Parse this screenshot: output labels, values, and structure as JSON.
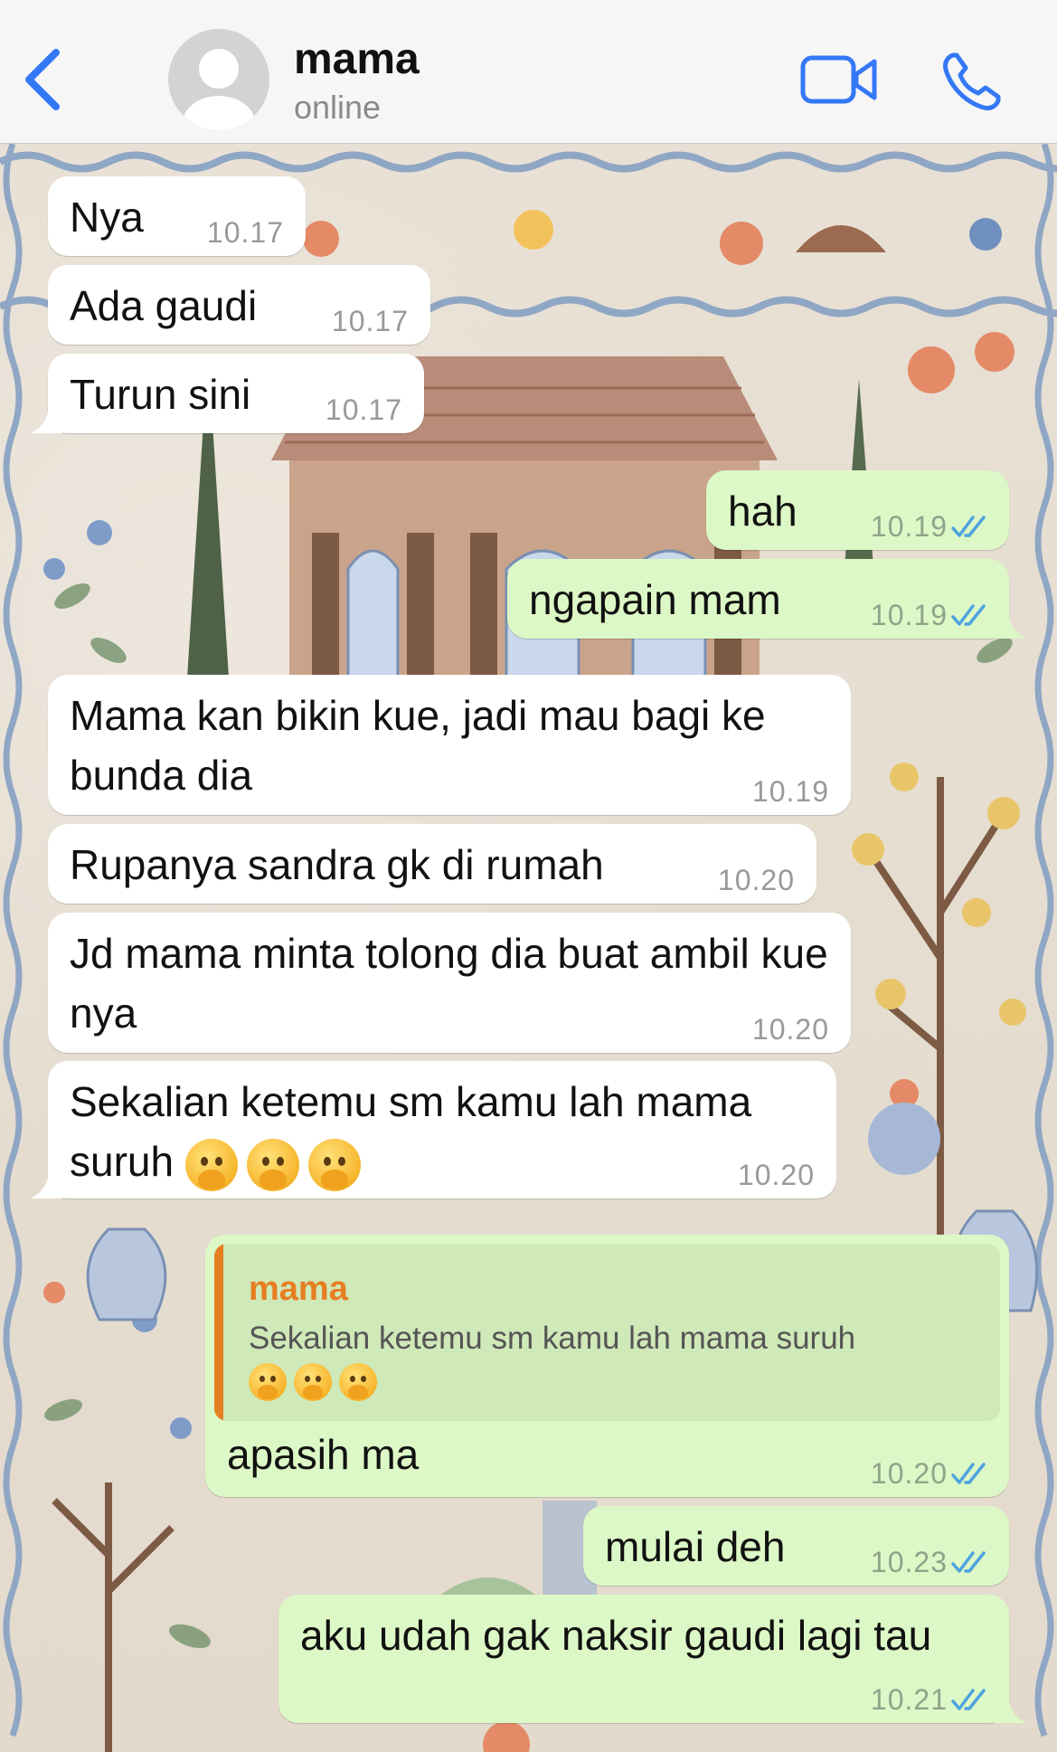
{
  "header": {
    "contact_name": "mama",
    "status": "online",
    "back_icon": "chevron-left-icon",
    "video_icon": "video-camera-icon",
    "call_icon": "phone-icon",
    "accent_color": "#3478f6"
  },
  "messages": [
    {
      "dir": "in",
      "text": "Nya",
      "time": "10.17"
    },
    {
      "dir": "in",
      "text": "Ada gaudi",
      "time": "10.17"
    },
    {
      "dir": "in",
      "text": "Turun sini",
      "time": "10.17"
    },
    {
      "dir": "out",
      "text": "hah",
      "time": "10.19",
      "read": true
    },
    {
      "dir": "out",
      "text": "ngapain mam",
      "time": "10.19",
      "read": true
    },
    {
      "dir": "in",
      "text": "Mama kan bikin kue, jadi mau bagi ke bunda dia",
      "time": "10.19"
    },
    {
      "dir": "in",
      "text": "Rupanya sandra gk di rumah",
      "time": "10.20"
    },
    {
      "dir": "in",
      "text": "Jd mama minta tolong dia buat ambil kue nya",
      "time": "10.20"
    },
    {
      "dir": "in",
      "text": "Sekalian ketemu sm kamu lah mama suruh",
      "emoji": "hand-over-mouth-emoji x3",
      "time": "10.20"
    },
    {
      "dir": "out",
      "quote_author": "mama",
      "quote_text": "Sekalian ketemu sm kamu lah mama suruh",
      "text": "apasih ma",
      "time": "10.20",
      "read": true
    },
    {
      "dir": "out",
      "text": "mulai deh",
      "time": "10.23",
      "read": true
    },
    {
      "dir": "out",
      "text": "aku udah gak naksir gaudi lagi tau",
      "time": "10.21",
      "read": true
    }
  ],
  "colors": {
    "incoming_bubble": "#ffffff",
    "outgoing_bubble": "#dcf8c6",
    "read_ticks": "#4fa3e0",
    "quote_accent": "#e67e22"
  }
}
